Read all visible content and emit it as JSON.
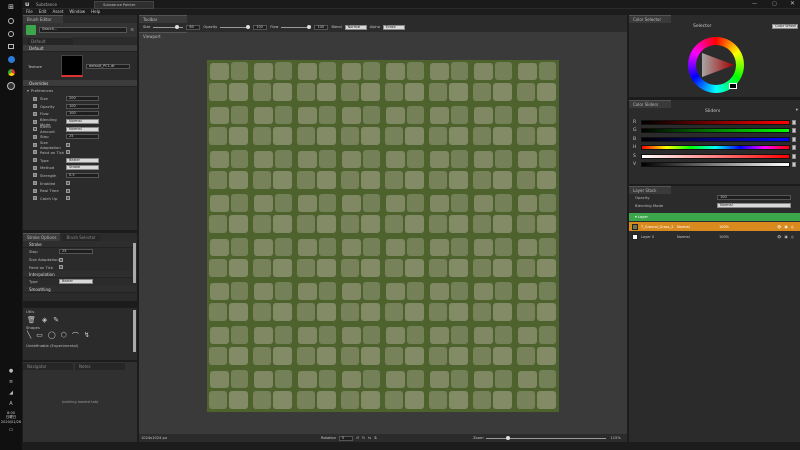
{
  "app": {
    "title": "Substance",
    "tab_title": "Substance Painter",
    "menu": [
      "File",
      "Edit",
      "Asset",
      "Window",
      "Help"
    ]
  },
  "taskbar": {
    "icons": [
      "search-icon",
      "circle-icon",
      "view-icon",
      "edge-icon",
      "chrome-icon",
      "unreal-icon"
    ],
    "tray_time": "8:00",
    "tray_day": "日曜日",
    "tray_date": "2020/01/26"
  },
  "brush_editor": {
    "tab_label": "Brush Editor",
    "brush_name": "Default",
    "search_placeholder": "Search...",
    "default_section": "Default",
    "texture_label": "Texture",
    "texture_value": "default_PC1.dt",
    "overrides_section": "Overrides",
    "preferences_section": "Preferences",
    "props": [
      {
        "label": "Size",
        "checked": true,
        "value": "200"
      },
      {
        "label": "Opacity",
        "checked": true,
        "value": "100"
      },
      {
        "label": "Flow",
        "checked": true,
        "value": "100"
      },
      {
        "label": "Blending Mode",
        "checked": true,
        "value": "Normal"
      },
      {
        "label": "Blend Amount",
        "checked": false,
        "value": "Normal"
      },
      {
        "label": "Step",
        "checked": true,
        "value": "25"
      },
      {
        "label": "Size Adaptation",
        "checked": true,
        "value": ""
      },
      {
        "label": "Paint on Tick",
        "checked": true,
        "value": ""
      },
      {
        "label": "Type",
        "checked": true,
        "value": "Bezier"
      },
      {
        "label": "Method",
        "checked": true,
        "value": "Stroke"
      },
      {
        "label": "Strength",
        "checked": true,
        "value": "0.5"
      },
      {
        "label": "Enabled",
        "checked": true,
        "value": ""
      },
      {
        "label": "Real Time",
        "checked": true,
        "value": ""
      },
      {
        "label": "Catch Up",
        "checked": true,
        "value": ""
      }
    ]
  },
  "stroke_options": {
    "tab_label": "Stroke Options",
    "tab2_label": "Brush Selector",
    "stroke_section": "Stroke",
    "step_label": "Step",
    "step_value": "25",
    "size_adapt_label": "Size Adaptation",
    "paint_tick_label": "Paint on Tick",
    "interp_section": "Interpolation",
    "type_label": "Type",
    "type_value": "Bezier",
    "smoothing_section": "Smoothing"
  },
  "tools": {
    "utils_label": "Utils",
    "shapes_label": "Shapes",
    "undefined_label": "Undefinable (Experimental)"
  },
  "bottom_left": {
    "tab1": "Navigator",
    "tab2": "Notes",
    "message": "(nothing loaded tab)"
  },
  "toolbar": {
    "tab_label": "Toolbar",
    "size_label": "Size",
    "size_value": "60",
    "opacity_label": "Opacity",
    "opacity_value": "100",
    "flow_label": "Flow",
    "flow_value": "100",
    "blend_label": "Blend",
    "blend_value": "Normal",
    "alpha_label": "Alpha",
    "alpha_value": "Erase"
  },
  "viewport": {
    "tab_label": "Viewport",
    "status_size": "1024x1024 px",
    "rotation_label": "Rotation",
    "rotation_value": "0",
    "zoom_label": "Zoom",
    "zoom_value": "115%"
  },
  "color_selector": {
    "tab_label": "Color Selector",
    "mode_label": "Selector",
    "mode_value": "Color Wheel"
  },
  "color_sliders": {
    "tab_label": "Color Sliders",
    "mode_label": "Sliders",
    "channels": [
      "R",
      "G",
      "B",
      "H",
      "S",
      "V"
    ]
  },
  "layers": {
    "tab_label": "Layer Stack",
    "opacity_label": "Opacity",
    "opacity_value": "100",
    "blend_label": "Blending Mode",
    "blend_value": "Normal",
    "group_name": "Layer",
    "items": [
      {
        "name": "T_Ground_Grass_2",
        "mode": "Normal",
        "opacity": "100%",
        "active": true
      },
      {
        "name": "Layer 0",
        "mode": "Normal",
        "opacity": "100%",
        "active": false
      }
    ]
  },
  "colors": {
    "accent_green": "#3ca64a",
    "accent_orange": "#d98a1e",
    "panel_bg": "#2b2b2b",
    "viewport_bg": "#3a3a3a"
  }
}
